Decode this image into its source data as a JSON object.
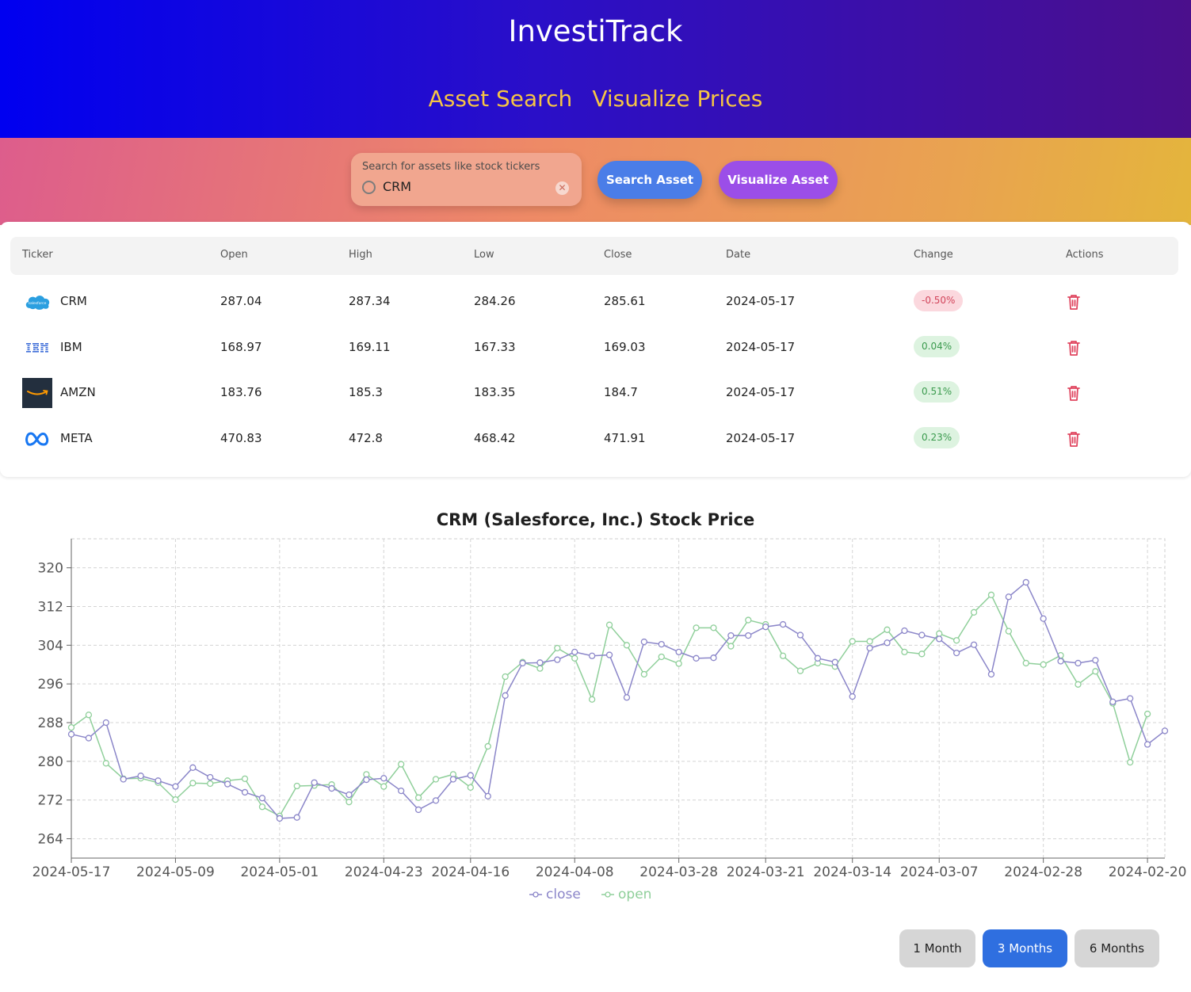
{
  "header": {
    "title": "InvestiTrack",
    "nav": [
      "Asset Search",
      "Visualize Prices"
    ]
  },
  "search": {
    "placeholder": "Search for assets like stock tickers",
    "value": "CRM",
    "search_button": "Search Asset",
    "visualize_button": "Visualize Asset"
  },
  "table": {
    "headers": [
      "Ticker",
      "Open",
      "High",
      "Low",
      "Close",
      "Date",
      "Change",
      "Actions"
    ],
    "rows": [
      {
        "ticker": "CRM",
        "logo": "salesforce-logo-icon",
        "open": "287.04",
        "high": "287.34",
        "low": "284.26",
        "close": "285.61",
        "date": "2024-05-17",
        "change": "-0.50%",
        "direction": "neg"
      },
      {
        "ticker": "IBM",
        "logo": "ibm-logo-icon",
        "open": "168.97",
        "high": "169.11",
        "low": "167.33",
        "close": "169.03",
        "date": "2024-05-17",
        "change": "0.04%",
        "direction": "pos"
      },
      {
        "ticker": "AMZN",
        "logo": "amazon-logo-icon",
        "open": "183.76",
        "high": "185.3",
        "low": "183.35",
        "close": "184.7",
        "date": "2024-05-17",
        "change": "0.51%",
        "direction": "pos"
      },
      {
        "ticker": "META",
        "logo": "meta-logo-icon",
        "open": "470.83",
        "high": "472.8",
        "low": "468.42",
        "close": "471.91",
        "date": "2024-05-17",
        "change": "0.23%",
        "direction": "pos"
      }
    ]
  },
  "colors": {
    "close": "#8b86c9",
    "open": "#8fcf9a",
    "negative": "#d2455b",
    "positive": "#3a9a4d",
    "active_button": "#2f6fe0"
  },
  "chart_data": {
    "type": "line",
    "title": "CRM (Salesforce, Inc.) Stock Price",
    "x_tick_labels": [
      "2024-05-17",
      "2024-05-09",
      "2024-05-01",
      "2024-04-23",
      "2024-04-16",
      "2024-04-08",
      "2024-03-28",
      "2024-03-21",
      "2024-03-14",
      "2024-03-07",
      "2024-02-28",
      "2024-02-20"
    ],
    "x_tick_index": [
      0,
      6,
      12,
      18,
      23,
      29,
      35,
      40,
      45,
      50,
      56,
      62
    ],
    "ylim": [
      260,
      326
    ],
    "y_ticks": [
      264,
      272,
      280,
      288,
      296,
      304,
      312,
      320
    ],
    "grid": true,
    "legend": "bottom-center",
    "series": [
      {
        "name": "close",
        "values": [
          285.6,
          284.8,
          288.0,
          276.3,
          277.0,
          276.0,
          274.8,
          278.7,
          276.7,
          275.3,
          273.6,
          272.4,
          268.2,
          268.4,
          275.6,
          274.4,
          273.1,
          276.2,
          276.5,
          273.9,
          270.0,
          271.9,
          276.3,
          277.1,
          272.8,
          293.6,
          300.3,
          300.4,
          301.0,
          302.6,
          301.8,
          302.0,
          293.2,
          304.7,
          304.2,
          302.6,
          301.3,
          301.4,
          306.0,
          306.0,
          307.8,
          308.3,
          306.1,
          301.3,
          300.5,
          293.4,
          303.4,
          304.5,
          307.0,
          306.1,
          305.3,
          302.4,
          304.1,
          298.0,
          314.0,
          317.0,
          309.5,
          300.7,
          300.3,
          300.9,
          292.3,
          293.0,
          283.5,
          286.3
        ]
      },
      {
        "name": "open",
        "values": [
          287.0,
          289.6,
          279.6,
          276.4,
          276.5,
          275.6,
          272.1,
          275.5,
          275.4,
          276.0,
          276.4,
          270.6,
          268.7,
          274.9,
          275.0,
          275.2,
          271.6,
          277.3,
          274.8,
          279.4,
          272.5,
          276.3,
          277.3,
          274.6,
          283.1,
          297.5,
          300.5,
          299.2,
          303.4,
          301.3,
          292.8,
          308.2,
          304.0,
          298.0,
          301.6,
          300.2,
          307.6,
          307.6,
          303.8,
          309.2,
          308.3,
          301.8,
          298.7,
          300.3,
          299.6,
          304.8,
          304.8,
          307.2,
          302.6,
          302.2,
          306.4,
          305.0,
          310.8,
          314.4,
          306.9,
          300.3,
          300.0,
          301.9,
          295.9,
          298.6,
          292.0,
          279.8,
          289.8
        ]
      }
    ]
  },
  "ranges": {
    "buttons": [
      "1 Month",
      "3 Months",
      "6 Months"
    ],
    "active": "3 Months"
  }
}
